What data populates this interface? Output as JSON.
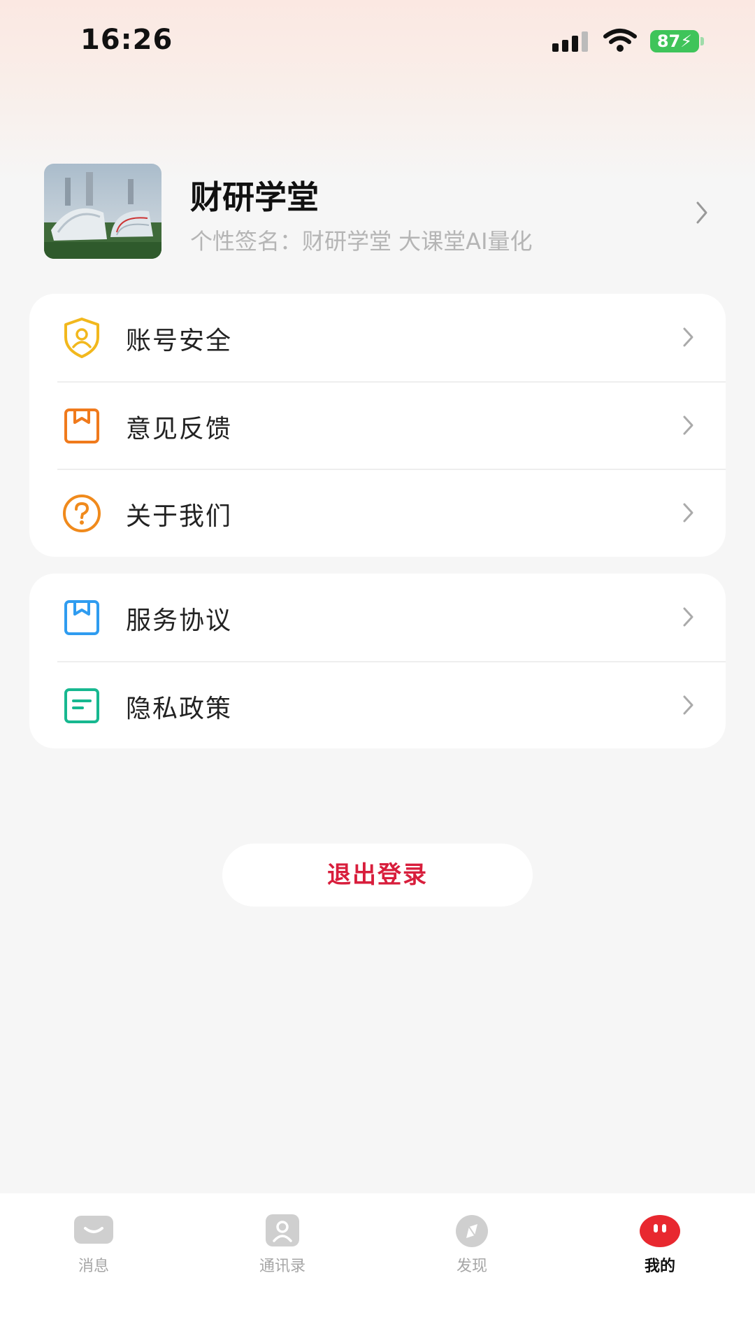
{
  "status_bar": {
    "time": "16:26",
    "battery": "87"
  },
  "profile": {
    "name": "财研学堂",
    "signature": "个性签名：财研学堂 大课堂AI量化"
  },
  "menu_group_1": [
    {
      "label": "账号安全",
      "icon": "shield-user-icon",
      "color": "#f2b81d"
    },
    {
      "label": "意见反馈",
      "icon": "bookmark-box-icon",
      "color": "#f07a1c"
    },
    {
      "label": "关于我们",
      "icon": "question-circle-icon",
      "color": "#f08a1c"
    }
  ],
  "menu_group_2": [
    {
      "label": "服务协议",
      "icon": "bookmark-box-icon",
      "color": "#2f9cf0"
    },
    {
      "label": "隐私政策",
      "icon": "document-lines-icon",
      "color": "#17b890"
    }
  ],
  "logout": {
    "label": "退出登录",
    "color": "#d81e3c"
  },
  "tabbar": {
    "tabs": [
      {
        "label": "消息",
        "icon": "message-icon"
      },
      {
        "label": "通讯录",
        "icon": "contacts-icon"
      },
      {
        "label": "发现",
        "icon": "compass-icon"
      },
      {
        "label": "我的",
        "icon": "me-face-icon",
        "active": true
      }
    ],
    "active_color": "#e8282f",
    "inactive_color": "#a6a6a6"
  }
}
